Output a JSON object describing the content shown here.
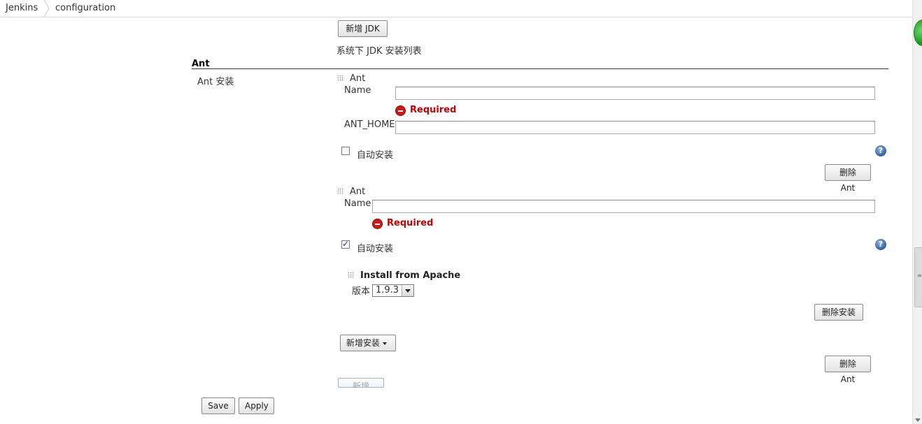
{
  "breadcrumb": {
    "items": [
      "Jenkins",
      "configuration"
    ]
  },
  "jdk": {
    "add_button": "新增 JDK",
    "list_caption": "系统下 JDK 安装列表"
  },
  "ant": {
    "section_title": "Ant",
    "row_label": "Ant 安装",
    "installations": [
      {
        "header": "Ant",
        "name_label": "Name",
        "name_value": "",
        "required_text": "Required",
        "home_label": "ANT_HOME",
        "home_value": "",
        "auto_install_label": "自动安装",
        "auto_install_checked": false,
        "delete_button": "删除 Ant"
      },
      {
        "header": "Ant",
        "name_label": "Name",
        "name_value": "",
        "required_text": "Required",
        "auto_install_label": "自动安装",
        "auto_install_checked": true,
        "installer": {
          "title": "Install from Apache",
          "version_label": "版本",
          "version_selected": "1.9.3",
          "delete_button": "删除安装"
        },
        "add_installer_button": "新增安装",
        "delete_button": "删除 Ant"
      }
    ],
    "add_button": "新增 Ant"
  },
  "help_icon_glyph": "?",
  "footer": {
    "save_button": "Save",
    "apply_button": "Apply"
  },
  "colors": {
    "required": "#cc0000",
    "status_ok": "#2aa52a",
    "help": "#2c5aa0"
  }
}
